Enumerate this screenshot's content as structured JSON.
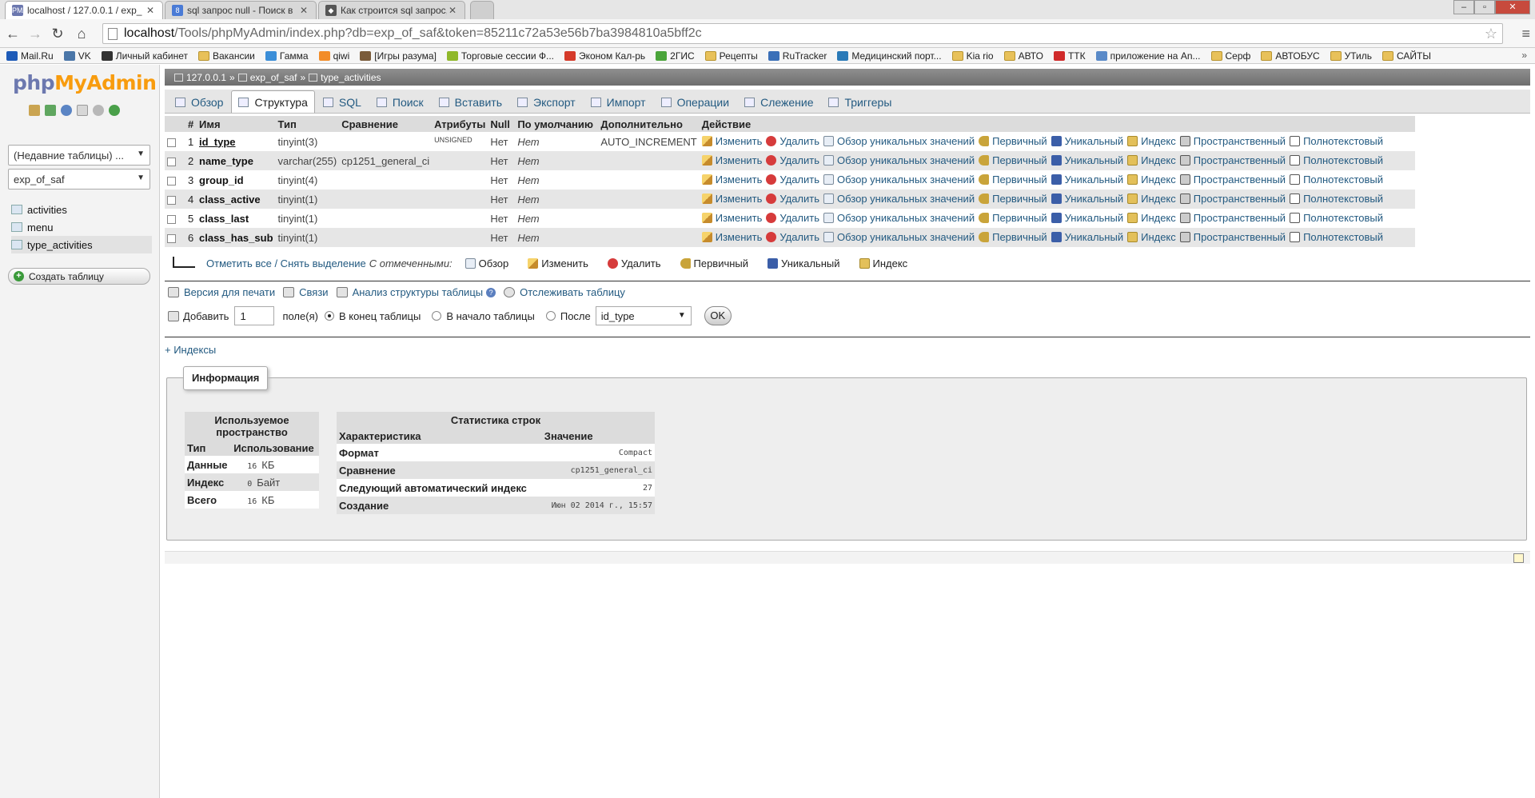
{
  "browser": {
    "tabs": [
      {
        "title": "localhost / 127.0.0.1 / exp_",
        "favicon": "PMA"
      },
      {
        "title": "sql запрос null - Поиск в",
        "favicon": "8"
      },
      {
        "title": "Как строится sql запрос,",
        "favicon": "◆"
      }
    ],
    "url_host": "localhost",
    "url_path": "/Tools/phpMyAdmin/index.php?db=exp_of_saf&token=85211c72a53e56b7ba3984810a5bff2c",
    "bookmarks": [
      "Mail.Ru",
      "VK",
      "Личный кабинет",
      "Вакансии",
      "Гамма",
      "qiwi",
      "[Игры разума]",
      "Торговые сессии Ф...",
      "Эконом Кал-рь",
      "2ГИС",
      "Рецепты",
      "RuTracker",
      "Медицинский порт...",
      "Kia rio",
      "АВТО",
      "ТТК",
      "приложение на An...",
      "Серф",
      "АВТОБУС",
      "УТиль",
      "САЙТЫ"
    ],
    "bookmarks_more": "»"
  },
  "nav": {
    "logo_a": "php",
    "logo_b": "MyAdmin",
    "recent_tables": "(Недавние таблицы) ...",
    "db_select": "exp_of_saf",
    "tables": [
      "activities",
      "menu",
      "type_activities"
    ],
    "create_table": "Создать таблицу"
  },
  "breadcrumb": {
    "server": "127.0.0.1",
    "db": "exp_of_saf",
    "table": "type_activities",
    "sep": "»"
  },
  "tabs": [
    "Обзор",
    "Структура",
    "SQL",
    "Поиск",
    "Вставить",
    "Экспорт",
    "Импорт",
    "Операции",
    "Слежение",
    "Триггеры"
  ],
  "structure": {
    "headers": [
      "#",
      "Имя",
      "Тип",
      "Сравнение",
      "Атрибуты",
      "Null",
      "По умолчанию",
      "Дополнительно",
      "Действие"
    ],
    "rows": [
      {
        "num": "1",
        "name": "id_type",
        "type": "tinyint(3)",
        "collation": "",
        "attributes": "UNSIGNED",
        "null": "Нет",
        "default": "Нет",
        "extra": "AUTO_INCREMENT"
      },
      {
        "num": "2",
        "name": "name_type",
        "type": "varchar(255)",
        "collation": "cp1251_general_ci",
        "attributes": "",
        "null": "Нет",
        "default": "Нет",
        "extra": ""
      },
      {
        "num": "3",
        "name": "group_id",
        "type": "tinyint(4)",
        "collation": "",
        "attributes": "",
        "null": "Нет",
        "default": "Нет",
        "extra": ""
      },
      {
        "num": "4",
        "name": "class_active",
        "type": "tinyint(1)",
        "collation": "",
        "attributes": "",
        "null": "Нет",
        "default": "Нет",
        "extra": ""
      },
      {
        "num": "5",
        "name": "class_last",
        "type": "tinyint(1)",
        "collation": "",
        "attributes": "",
        "null": "Нет",
        "default": "Нет",
        "extra": ""
      },
      {
        "num": "6",
        "name": "class_has_sub",
        "type": "tinyint(1)",
        "collation": "",
        "attributes": "",
        "null": "Нет",
        "default": "Нет",
        "extra": ""
      }
    ],
    "actions": {
      "edit": "Изменить",
      "delete": "Удалить",
      "browse_distinct": "Обзор уникальных значений",
      "primary": "Первичный",
      "unique": "Уникальный",
      "index": "Индекс",
      "spatial": "Пространственный",
      "fulltext": "Полнотекстовый"
    }
  },
  "with_selected": {
    "check_all": "Отметить все / Снять выделение",
    "label": "С отмеченными:",
    "browse": "Обзор",
    "edit": "Изменить",
    "delete": "Удалить",
    "primary": "Первичный",
    "unique": "Уникальный",
    "index": "Индекс"
  },
  "tools": {
    "print": "Версия для печати",
    "relations": "Связи",
    "analyze": "Анализ структуры таблицы",
    "track": "Отслеживать таблицу"
  },
  "add_field": {
    "label": "Добавить",
    "count": "1",
    "fields_label": "поле(я)",
    "at_end": "В конец таблицы",
    "at_beginning": "В начало таблицы",
    "after": "После",
    "after_field": "id_type",
    "ok": "OK"
  },
  "indexes_toggle": "+ Индексы",
  "info": {
    "legend": "Информация",
    "space": {
      "caption": "Используемое пространство",
      "headers": [
        "Тип",
        "Использование"
      ],
      "rows": [
        {
          "type": "Данные",
          "value": "16",
          "unit": "КБ"
        },
        {
          "type": "Индекс",
          "value": "0",
          "unit": "Байт"
        },
        {
          "type": "Всего",
          "value": "16",
          "unit": "КБ"
        }
      ]
    },
    "stats": {
      "caption": "Статистика строк",
      "headers": [
        "Характеристика",
        "Значение"
      ],
      "rows": [
        {
          "k": "Формат",
          "v": "Compact"
        },
        {
          "k": "Сравнение",
          "v": "cp1251_general_ci"
        },
        {
          "k": "Следующий автоматический индекс",
          "v": "27"
        },
        {
          "k": "Создание",
          "v": "Июн 02 2014 г., 15:57"
        }
      ]
    }
  }
}
